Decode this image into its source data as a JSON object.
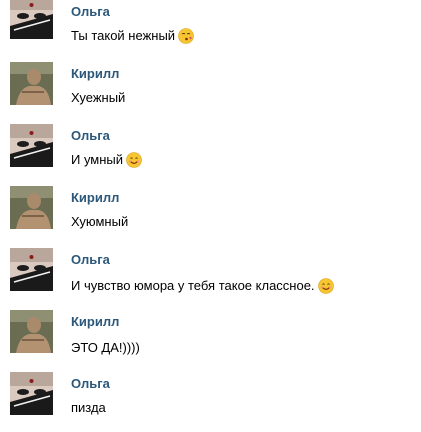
{
  "messages": [
    {
      "author": "Ольга",
      "text": "Ты такой нежный",
      "emoji": "kissing-face-icon",
      "avatar": "olga"
    },
    {
      "author": "Кирилл",
      "text": "Хуежный",
      "emoji": null,
      "avatar": "kirill"
    },
    {
      "author": "Ольга",
      "text": "И умный",
      "emoji": "smiling-face-icon",
      "avatar": "olga"
    },
    {
      "author": "Кирилл",
      "text": "Хуюмный",
      "emoji": null,
      "avatar": "kirill"
    },
    {
      "author": "Ольга",
      "text": "И чувство юмора у тебя такое классное.",
      "emoji": "smiling-face-icon",
      "avatar": "olga"
    },
    {
      "author": "Кирилл",
      "text": "ЭТО ДА!))))",
      "emoji": null,
      "avatar": "kirill"
    },
    {
      "author": "Ольга",
      "text": "пизда",
      "emoji": null,
      "avatar": "olga"
    }
  ],
  "colors": {
    "author": "#2b587a",
    "text": "#000000",
    "background": "#ffffff",
    "emoji_face": "#f7c531"
  }
}
